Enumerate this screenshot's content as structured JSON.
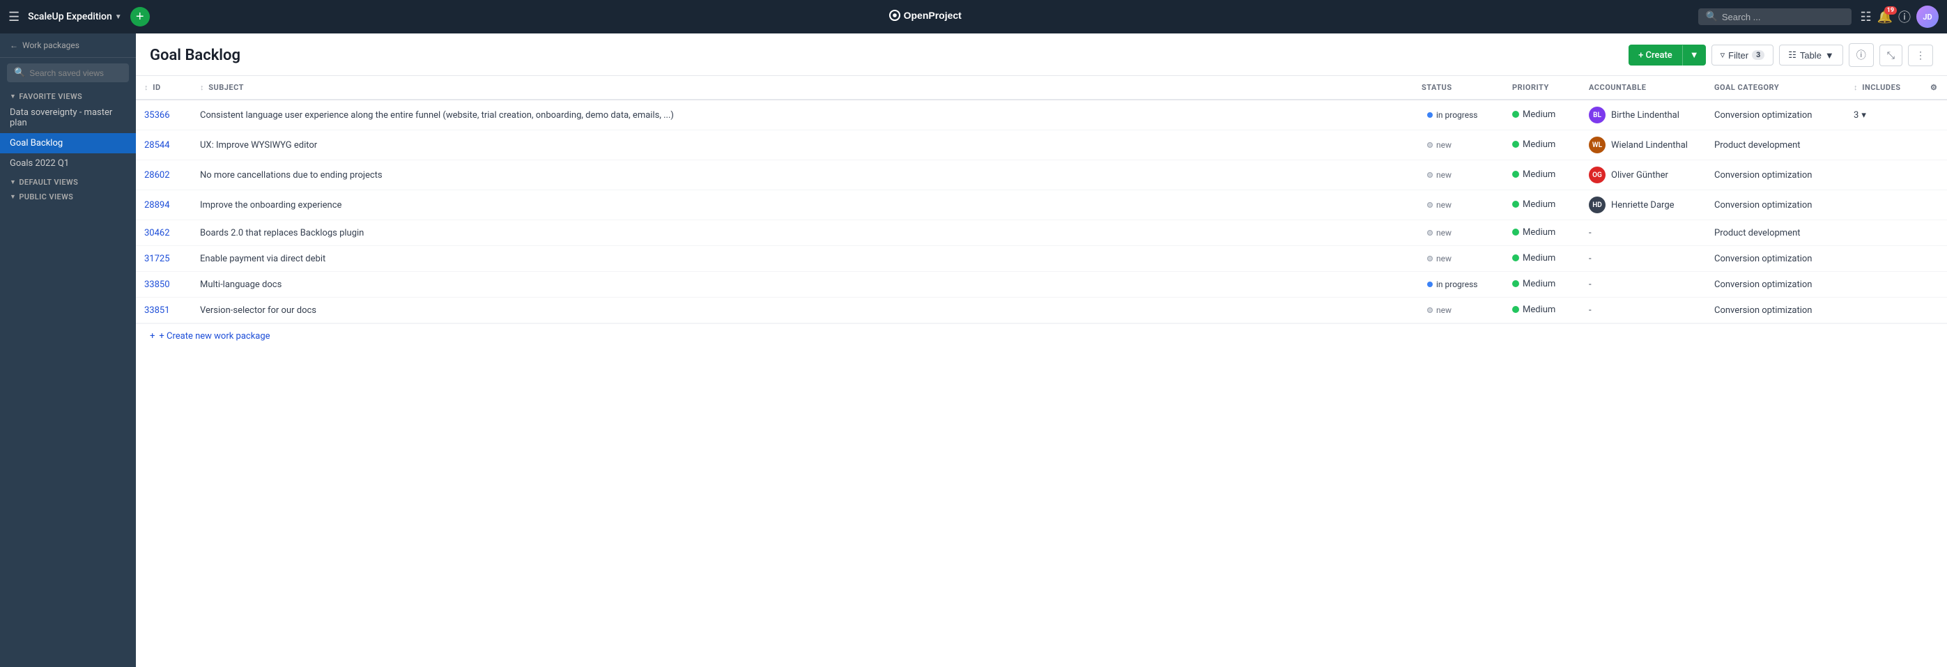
{
  "app": {
    "title": "OpenProject",
    "project_name": "ScaleUp Expedition",
    "add_btn_label": "+"
  },
  "top_nav": {
    "search_placeholder": "Search ...",
    "notification_count": "19"
  },
  "sidebar": {
    "back_label": "Work packages",
    "search_placeholder": "Search saved views",
    "favorite_views_label": "Favorite Views",
    "default_views_label": "Default Views",
    "public_views_label": "Public Views",
    "items": [
      {
        "id": "data-sovereignty",
        "label": "Data sovereignty - master plan",
        "active": false
      },
      {
        "id": "goal-backlog",
        "label": "Goal Backlog",
        "active": true
      },
      {
        "id": "goals-2022",
        "label": "Goals 2022 Q1",
        "active": false
      }
    ]
  },
  "page": {
    "title": "Goal Backlog",
    "create_label": "+ Create",
    "filter_label": "Filter",
    "filter_count": "3",
    "table_label": "Table",
    "create_new_label": "+ Create new work package"
  },
  "table": {
    "columns": [
      {
        "id": "id",
        "label": "ID",
        "sortable": true
      },
      {
        "id": "subject",
        "label": "Subject",
        "sortable": true
      },
      {
        "id": "status",
        "label": "Status",
        "sortable": false
      },
      {
        "id": "priority",
        "label": "Priority",
        "sortable": false
      },
      {
        "id": "accountable",
        "label": "Accountable",
        "sortable": false
      },
      {
        "id": "goal-category",
        "label": "Goal Category",
        "sortable": false
      },
      {
        "id": "includes",
        "label": "Includes",
        "sortable": true
      },
      {
        "id": "settings",
        "label": "",
        "sortable": false
      }
    ],
    "rows": [
      {
        "id": "35366",
        "subject": "Consistent language user experience along the entire funnel (website, trial creation, onboarding, demo data, emails, ...)",
        "status": "in progress",
        "status_class": "status-in-progress",
        "priority": "Medium",
        "priority_color": "#22c55e",
        "accountable": "Birthe Lindenthal",
        "accountable_color": "#7c3aed",
        "accountable_initials": "BL",
        "goal_category": "Conversion optimization",
        "includes": "3",
        "has_includes": true
      },
      {
        "id": "28544",
        "subject": "UX: Improve WYSIWYG editor",
        "status": "new",
        "status_class": "status-new",
        "priority": "Medium",
        "priority_color": "#22c55e",
        "accountable": "Wieland Lindenthal",
        "accountable_color": "#b45309",
        "accountable_initials": "WL",
        "goal_category": "Product development",
        "includes": "",
        "has_includes": false
      },
      {
        "id": "28602",
        "subject": "No more cancellations due to ending projects",
        "status": "new",
        "status_class": "status-new",
        "priority": "Medium",
        "priority_color": "#22c55e",
        "accountable": "Oliver Günther",
        "accountable_color": "#dc2626",
        "accountable_initials": "OG",
        "goal_category": "Conversion optimization",
        "includes": "",
        "has_includes": false
      },
      {
        "id": "28894",
        "subject": "Improve the onboarding experience",
        "status": "new",
        "status_class": "status-new",
        "priority": "Medium",
        "priority_color": "#22c55e",
        "accountable": "Henriette Darge",
        "accountable_color": "#374151",
        "accountable_initials": "HD",
        "goal_category": "Conversion optimization",
        "includes": "",
        "has_includes": false
      },
      {
        "id": "30462",
        "subject": "Boards 2.0 that replaces Backlogs plugin",
        "status": "new",
        "status_class": "status-new",
        "priority": "Medium",
        "priority_color": "#22c55e",
        "accountable": "-",
        "accountable_color": "",
        "accountable_initials": "",
        "goal_category": "Product development",
        "includes": "",
        "has_includes": false
      },
      {
        "id": "31725",
        "subject": "Enable payment via direct debit",
        "status": "new",
        "status_class": "status-new",
        "priority": "Medium",
        "priority_color": "#22c55e",
        "accountable": "-",
        "accountable_color": "",
        "accountable_initials": "",
        "goal_category": "Conversion optimization",
        "includes": "",
        "has_includes": false
      },
      {
        "id": "33850",
        "subject": "Multi-language docs",
        "status": "in progress",
        "status_class": "status-in-progress",
        "priority": "Medium",
        "priority_color": "#22c55e",
        "accountable": "-",
        "accountable_color": "",
        "accountable_initials": "",
        "goal_category": "Conversion optimization",
        "includes": "",
        "has_includes": false
      },
      {
        "id": "33851",
        "subject": "Version-selector for our docs",
        "status": "new",
        "status_class": "status-new",
        "priority": "Medium",
        "priority_color": "#22c55e",
        "accountable": "-",
        "accountable_color": "",
        "accountable_initials": "",
        "goal_category": "Conversion optimization",
        "includes": "",
        "has_includes": false
      }
    ]
  }
}
